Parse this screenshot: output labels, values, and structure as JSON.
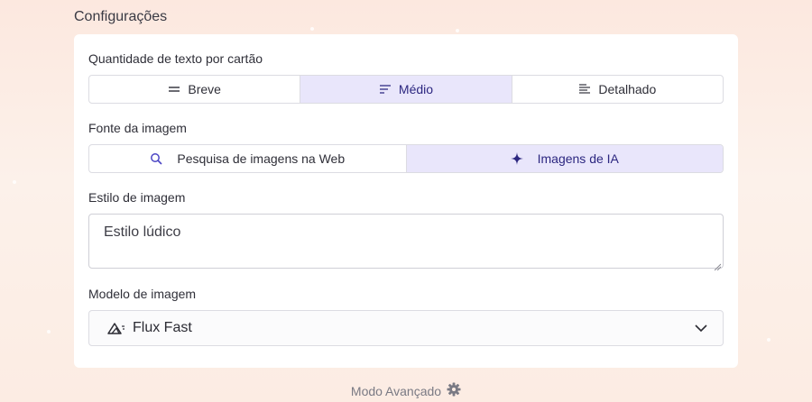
{
  "section_title": "Configurações",
  "text_amount": {
    "label": "Quantidade de texto por cartão",
    "options": [
      {
        "label": "Breve",
        "icon": "short-lines-icon",
        "active": false
      },
      {
        "label": "Médio",
        "icon": "medium-lines-icon",
        "active": true
      },
      {
        "label": "Detalhado",
        "icon": "detailed-lines-icon",
        "active": false
      }
    ]
  },
  "image_source": {
    "label": "Fonte da imagem",
    "options": [
      {
        "label": "Pesquisa de imagens na Web",
        "icon": "search-icon",
        "active": false
      },
      {
        "label": "Imagens de IA",
        "icon": "sparkle-icon",
        "active": true
      }
    ]
  },
  "image_style": {
    "label": "Estilo de imagem",
    "value": "Estilo lúdico"
  },
  "image_model": {
    "label": "Modelo de imagem",
    "value": "Flux Fast",
    "icon": "mountain-icon"
  },
  "advanced_mode": {
    "label": "Modo Avançado",
    "icon": "gear-icon"
  },
  "colors": {
    "accent_bg": "#e9e6fb",
    "accent_text": "#2c2780",
    "border": "#dcdce2"
  }
}
